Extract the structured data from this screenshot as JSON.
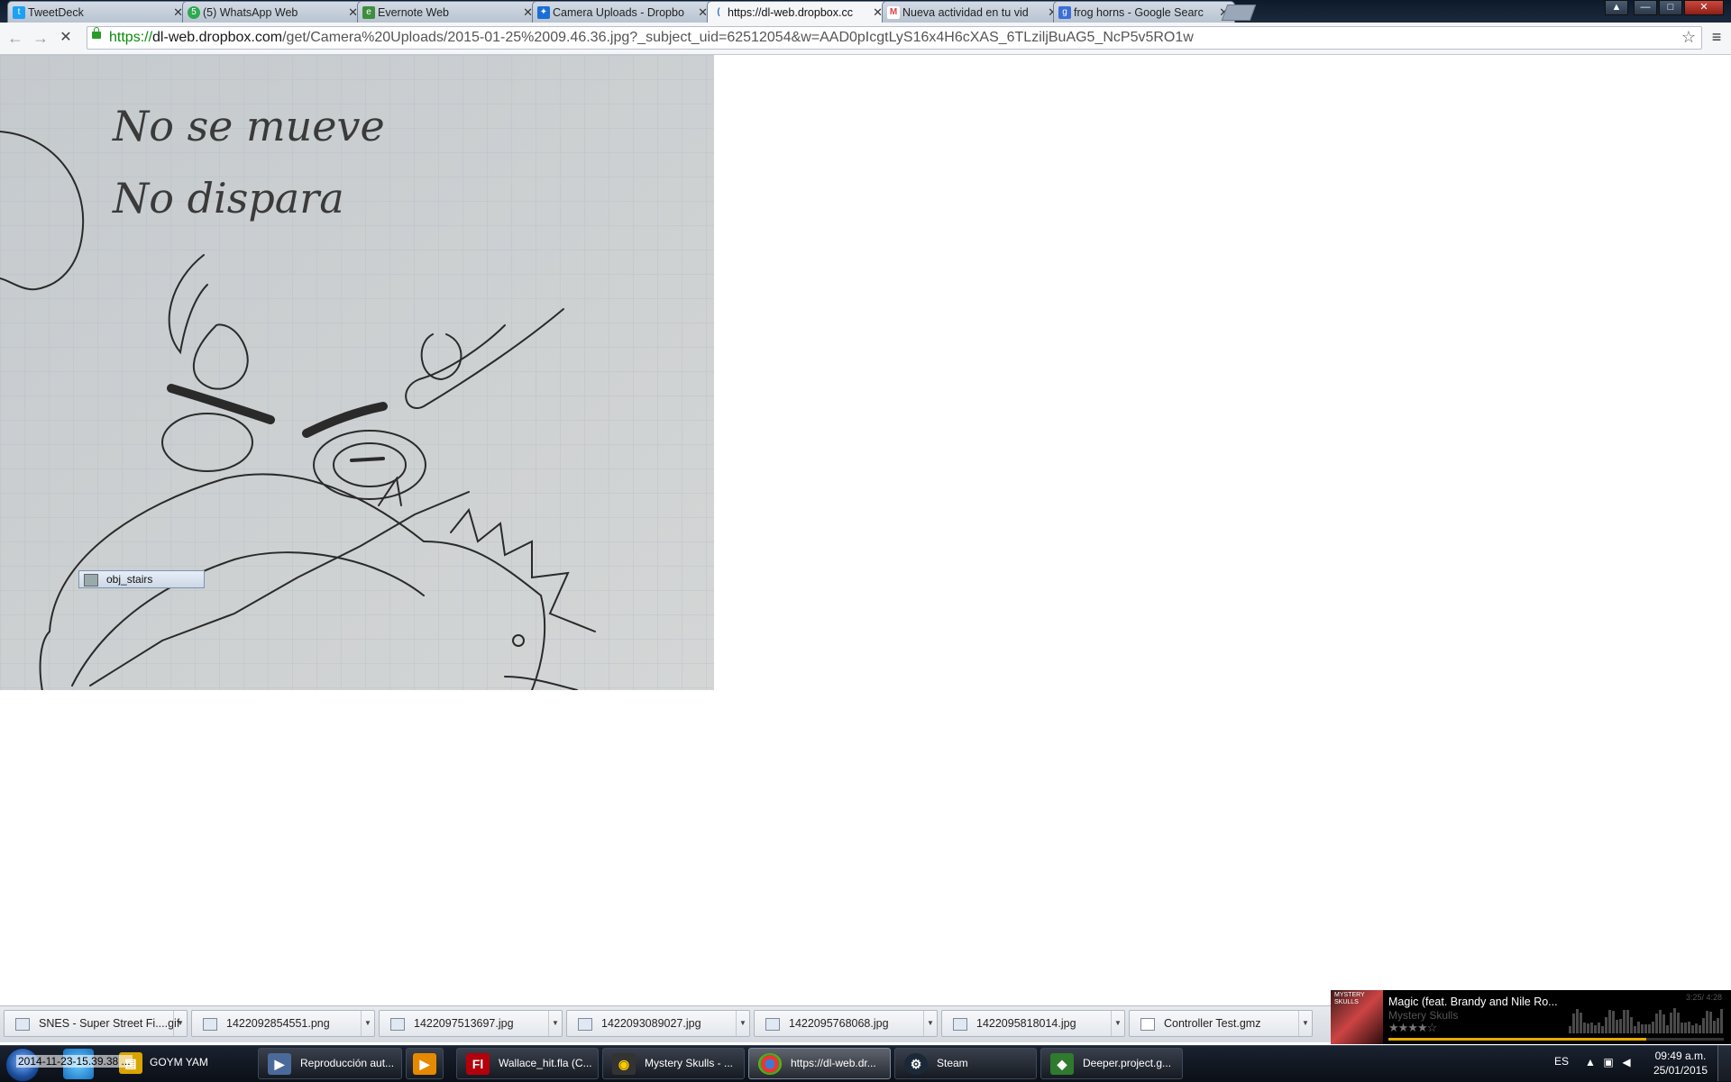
{
  "tabs": [
    {
      "title": "TweetDeck",
      "favicon_color": "#1da1f2",
      "favicon_glyph": "t"
    },
    {
      "title": "(5) WhatsApp Web",
      "favicon_color": "#2fa84f",
      "favicon_glyph": "5"
    },
    {
      "title": "Evernote Web",
      "favicon_color": "#3d8f3d",
      "favicon_glyph": "e"
    },
    {
      "title": "Camera Uploads - Dropbo",
      "favicon_color": "#1a6fd6",
      "favicon_glyph": "✦"
    },
    {
      "title": "https://dl-web.dropbox.cc",
      "favicon_color": "#5a7fb0",
      "favicon_glyph": "(",
      "active": true
    },
    {
      "title": "Nueva actividad en tu vid",
      "favicon_color": "#d44",
      "favicon_glyph": "M"
    },
    {
      "title": "frog horns - Google Searc",
      "favicon_color": "#3b6fd6",
      "favicon_glyph": "g"
    }
  ],
  "window_controls": {
    "minimize": "—",
    "maximize": "□",
    "close": "✕"
  },
  "toolbar": {
    "back_icon": "←",
    "forward_icon": "→",
    "stop_icon": "✕",
    "url_scheme": "https://",
    "url_host": "dl-web.dropbox.com",
    "url_path": "/get/Camera%20Uploads/2015-01-25%2009.46.36.jpg?_subject_uid=62512054&w=AAD0pIcgtLyS16x4H6cXAS_6TLziljBuAG5_NcP5v5RO1w",
    "star_icon": "☆",
    "menu_icon": "≡"
  },
  "content": {
    "tooltip": "obj_stairs",
    "sketch_text_1": "No se mueve",
    "sketch_text_2": "No dispara"
  },
  "downloads": [
    {
      "name": "SNES - Super Street Fi....gif"
    },
    {
      "name": "1422092854551.png"
    },
    {
      "name": "1422097513697.jpg"
    },
    {
      "name": "1422093089027.jpg"
    },
    {
      "name": "1422095768068.jpg"
    },
    {
      "name": "1422095818014.jpg"
    },
    {
      "name": "Controller Test.gmz"
    }
  ],
  "media": {
    "cover_text": "MYSTERY SKULLS",
    "title": "Magic (feat. Brandy and Nile Ro...",
    "artist": "Mystery Skulls",
    "rating": "★★★★☆",
    "time": "3:25/ 4:28",
    "progress": 0.77
  },
  "taskbar": {
    "overlay_text": "2014-11-23-15.39.38 ...",
    "items": [
      {
        "label": "GOYM YAM",
        "icon_color": "#d9a400",
        "icon_glyph": "▤"
      },
      {
        "label": "Reproducción aut...",
        "icon_color": "#4a6a9a",
        "icon_glyph": "▶"
      },
      {
        "label": "",
        "icon_color": "#e58a00",
        "icon_glyph": "▶"
      },
      {
        "label": "Wallace_hit.fla (C...",
        "icon_color": "#b3000c",
        "icon_glyph": "Fl"
      },
      {
        "label": "Mystery Skulls - ...",
        "icon_color": "#333",
        "icon_glyph": "◉"
      },
      {
        "label": "https://dl-web.dr...",
        "icon_color": "#e8e8e8",
        "icon_glyph": "◎",
        "active": true
      },
      {
        "label": "Steam",
        "icon_color": "#1b2838",
        "icon_glyph": "⚙"
      },
      {
        "label": "Deeper.project.g...",
        "icon_color": "#2f7a2f",
        "icon_glyph": "◆"
      }
    ]
  },
  "tray": {
    "language": "ES",
    "time": "09:49 a.m.",
    "date": "25/01/2015"
  }
}
